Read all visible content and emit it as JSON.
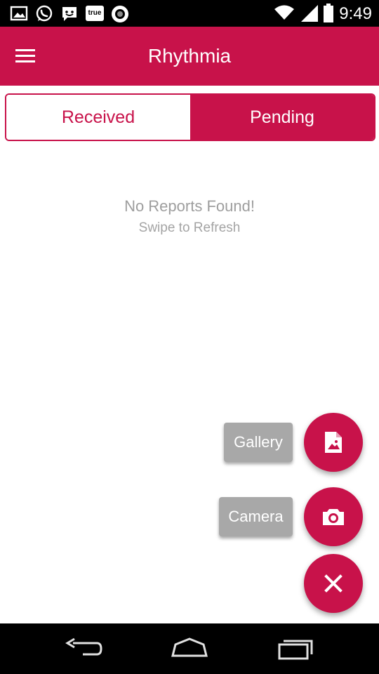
{
  "status_bar": {
    "time": "9:49",
    "left_icons": [
      "image-icon",
      "whatsapp-icon",
      "messenger-icon",
      "truemoney-icon",
      "circle-app-icon"
    ],
    "right_icons": [
      "wifi-icon",
      "signal-icon",
      "battery-icon"
    ],
    "truemoney_text": "true"
  },
  "app_bar": {
    "title": "Rhythmia",
    "menu_icon": "hamburger-menu-icon"
  },
  "tabs": {
    "received": "Received",
    "pending": "Pending",
    "active": "Pending"
  },
  "empty_state": {
    "title": "No Reports Found!",
    "subtitle": "Swipe to Refresh"
  },
  "fab_menu": {
    "gallery_label": "Gallery",
    "camera_label": "Camera",
    "gallery_icon": "image-file-icon",
    "camera_icon": "camera-icon",
    "close_icon": "close-icon"
  },
  "nav_bar": {
    "icons": [
      "back-icon",
      "home-icon",
      "recents-icon"
    ]
  },
  "colors": {
    "accent": "#c8124a",
    "label_bg": "#a8a8a8",
    "empty_text": "#9e9e9e"
  }
}
